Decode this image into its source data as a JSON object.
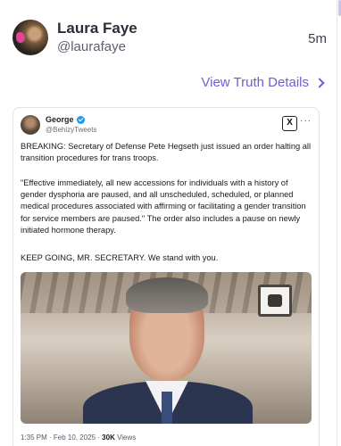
{
  "post": {
    "display_name": "Laura Faye",
    "handle": "@laurafaye",
    "time": "5m",
    "view_details": "View Truth Details"
  },
  "quoted": {
    "name": "George",
    "handle": "@BehizyTweets",
    "logo": "X",
    "more": "···",
    "paragraphs": [
      "BREAKING: Secretary of Defense Pete Hegseth just issued an order halting all transition procedures for trans troops.",
      "\"Effective immediately, all new accessions for individuals with a history of gender dysphoria are paused, and all unscheduled, scheduled, or planned medical procedures associated with affirming or facilitating a gender transition for service members are paused.\" The order also includes a pause on newly initiated hormone therapy.",
      "KEEP GOING, MR. SECRETARY. We stand with you."
    ],
    "meta_time": "1:35 PM · Feb 10, 2025 · ",
    "views_count": "30K",
    "views_label": " Views"
  },
  "icons": {
    "verified": "verified-badge-icon",
    "chevron": "chevron-right-icon",
    "x_logo": "x-logo-icon",
    "more": "more-icon"
  },
  "colors": {
    "accent": "#6b5fd3",
    "verified": "#1d9bf0"
  }
}
